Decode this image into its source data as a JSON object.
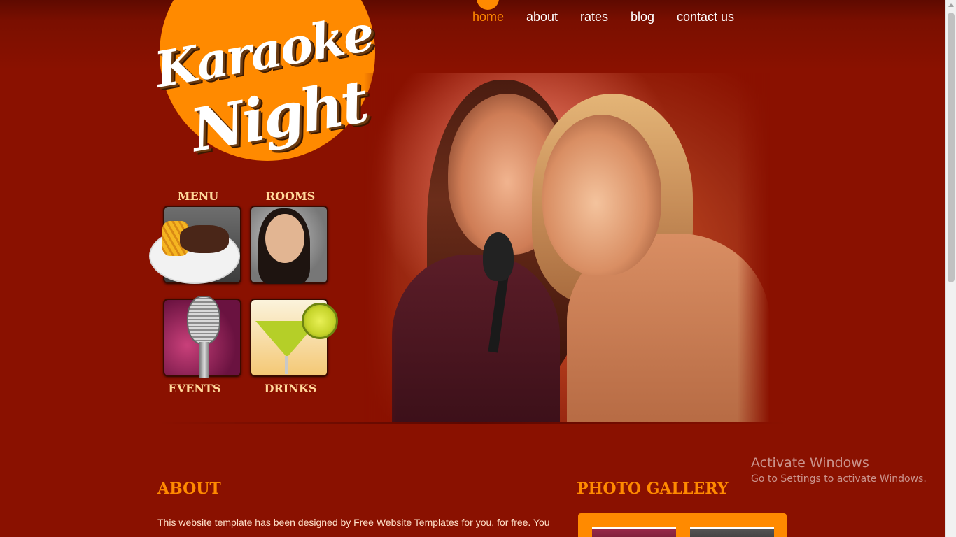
{
  "logo": {
    "line1": "Karaoke",
    "line2": "Night"
  },
  "nav": {
    "items": [
      {
        "label": "home",
        "active": true
      },
      {
        "label": "about",
        "active": false
      },
      {
        "label": "rates",
        "active": false
      },
      {
        "label": "blog",
        "active": false
      },
      {
        "label": "contact us",
        "active": false
      }
    ]
  },
  "tiles": {
    "menu": "MENU",
    "rooms": "ROOMS",
    "events": "EVENTS",
    "drinks": "DRINKS"
  },
  "about": {
    "title": "ABOUT",
    "text": "This website template has been designed by Free Website Templates for you, for free. You"
  },
  "gallery": {
    "title": "PHOTO GALLERY"
  },
  "watermark": {
    "line1": "Activate Windows",
    "line2": "Go to Settings to activate Windows."
  },
  "colors": {
    "background": "#8a1100",
    "accent": "#ff8a00",
    "tile_label": "#ffd89a"
  }
}
